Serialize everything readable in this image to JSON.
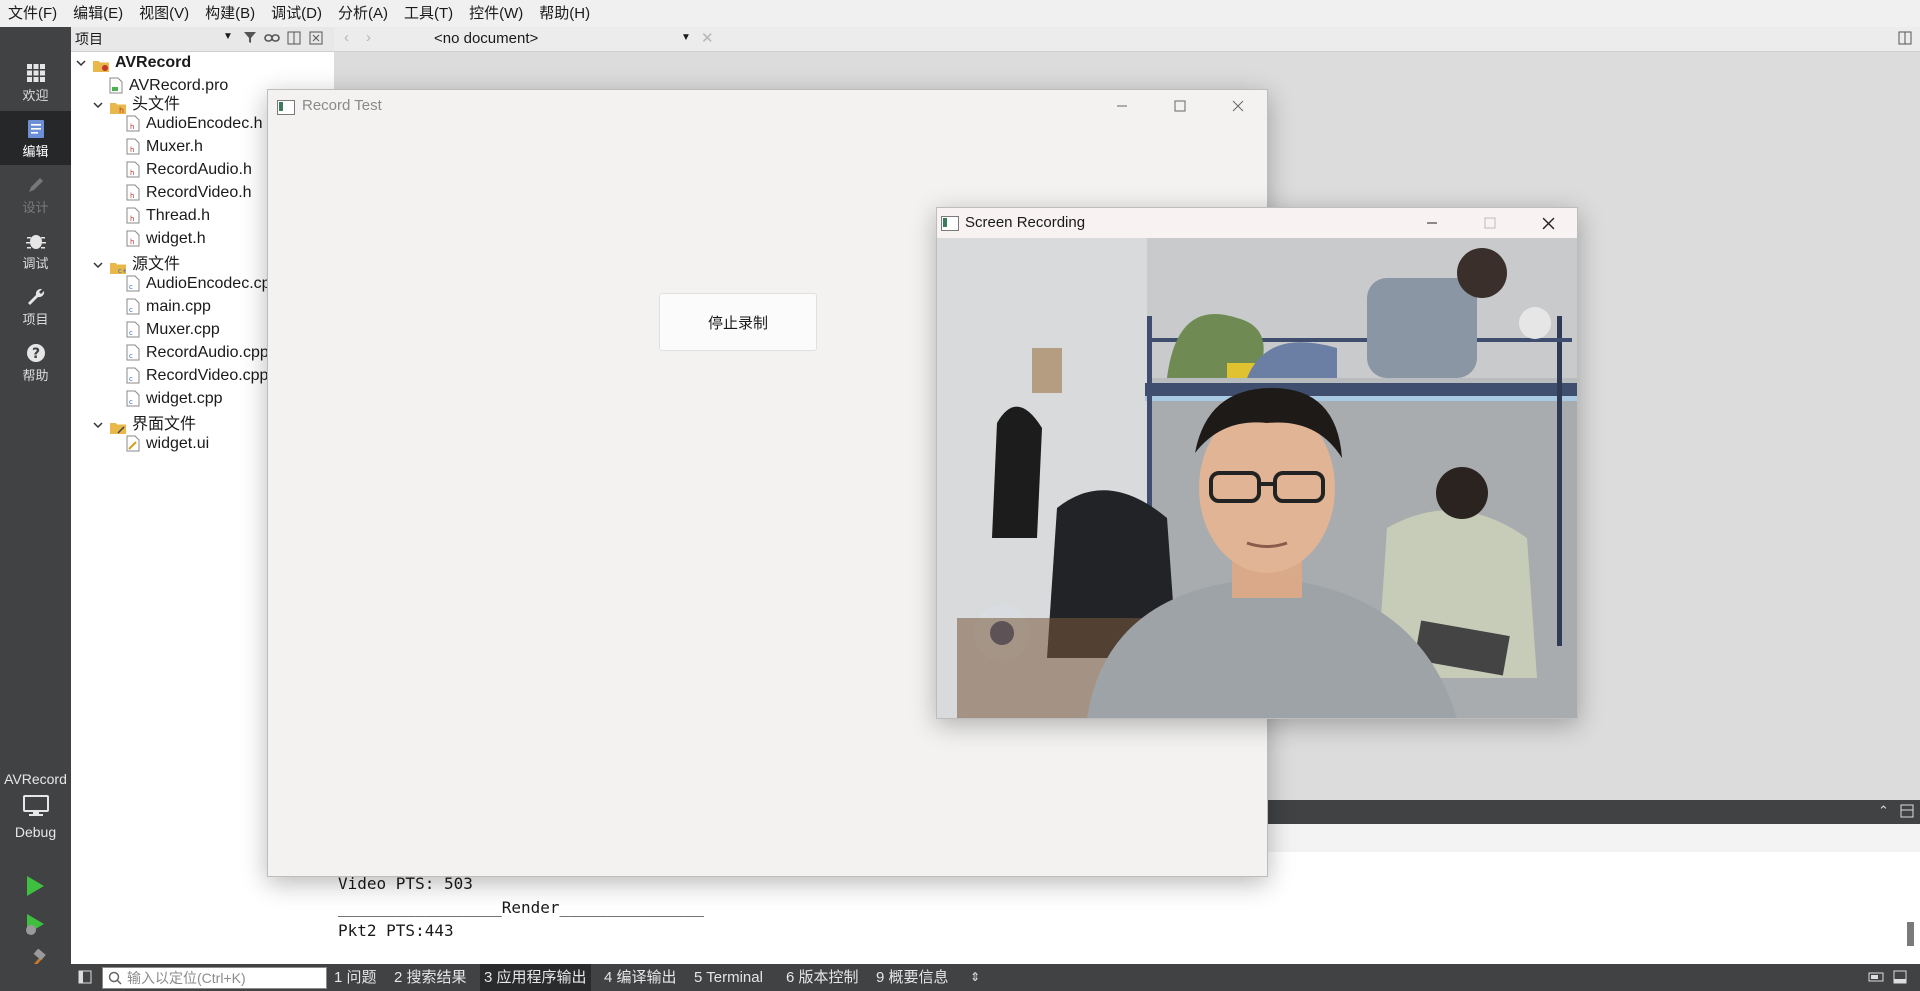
{
  "menu": [
    "文件(F)",
    "编辑(E)",
    "视图(V)",
    "构建(B)",
    "调试(D)",
    "分析(A)",
    "工具(T)",
    "控件(W)",
    "帮助(H)"
  ],
  "modes": [
    {
      "label": "欢迎",
      "icon": "grid-icon"
    },
    {
      "label": "编辑",
      "icon": "document-icon"
    },
    {
      "label": "设计",
      "icon": "pencil-icon"
    },
    {
      "label": "调试",
      "icon": "bug-icon"
    },
    {
      "label": "项目",
      "icon": "wrench-icon"
    },
    {
      "label": "帮助",
      "icon": "help-icon"
    }
  ],
  "kit": {
    "project": "AVRecord",
    "config": "Debug"
  },
  "projects_panel": {
    "title": "项目",
    "root": "AVRecord",
    "pro_file": "AVRecord.pro",
    "headers_label": "头文件",
    "headers": [
      "AudioEncodec.h",
      "Muxer.h",
      "RecordAudio.h",
      "RecordVideo.h",
      "Thread.h",
      "widget.h"
    ],
    "sources_label": "源文件",
    "sources": [
      "AudioEncodec.cpp",
      "main.cpp",
      "Muxer.cpp",
      "RecordAudio.cpp",
      "RecordVideo.cpp",
      "widget.cpp"
    ],
    "forms_label": "界面文件",
    "forms": [
      "widget.ui"
    ]
  },
  "editor": {
    "document": "<no document>"
  },
  "output": {
    "lines": [
      "Video PTS: 503",
      "_________________Render_______________",
      "Pkt2 PTS:443"
    ]
  },
  "statusbar": {
    "locator_placeholder": "输入以定位(Ctrl+K)",
    "tabs": [
      "1 问题",
      "2 搜索结果",
      "3 应用程序输出",
      "4 编译输出",
      "5 Terminal",
      "6 版本控制",
      "9 概要信息"
    ]
  },
  "record_window": {
    "title": "Record Test",
    "stop_button": "停止录制"
  },
  "screen_window": {
    "title": "Screen Recording"
  },
  "colors": {
    "modebar": "#404244",
    "active_mode": "#262729",
    "run_green": "#3fbf3f"
  }
}
